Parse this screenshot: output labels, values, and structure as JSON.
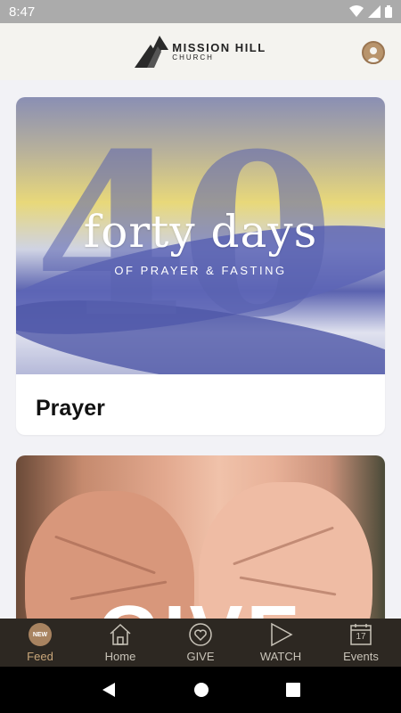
{
  "status_bar": {
    "time": "8:47"
  },
  "header": {
    "logo_line1": "MISSION HILL",
    "logo_line2": "CHURCH"
  },
  "feed": {
    "cards": [
      {
        "hero_title": "forty days",
        "hero_subtitle": "OF PRAYER & FASTING",
        "hero_number": "40",
        "title": "Prayer"
      },
      {
        "hero_text": "GIVE"
      }
    ]
  },
  "bottom_nav": {
    "items": [
      {
        "label": "Feed",
        "badge": "NEW",
        "icon": "new-badge-icon",
        "active": true
      },
      {
        "label": "Home",
        "icon": "home-icon"
      },
      {
        "label": "GIVE",
        "icon": "heart-circle-icon"
      },
      {
        "label": "WATCH",
        "icon": "play-icon"
      },
      {
        "label": "Events",
        "icon": "calendar-icon",
        "day": "17"
      }
    ]
  },
  "colors": {
    "accent": "#c9a77a",
    "nav_bg": "#2d2822",
    "header_bg": "#f4f3ef"
  }
}
